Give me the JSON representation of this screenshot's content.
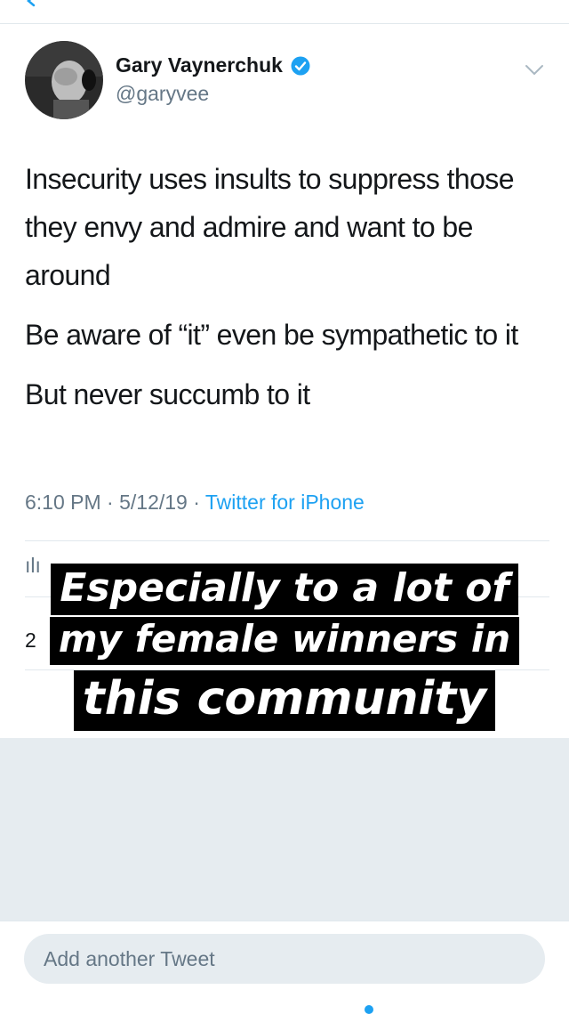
{
  "tweet": {
    "author_name": "Gary Vaynerchuk",
    "handle": "@garyvee",
    "paragraphs": [
      "Insecurity uses insults to suppress those they envy and admire and want to be around",
      "Be aware of “it” even be sympathetic to it",
      "But never succumb to it"
    ],
    "time": "6:10 PM · 5/12/19 ·",
    "source": "Twitter for iPhone",
    "stats_partial": "ılı",
    "count_partial": "2"
  },
  "reply": {
    "placeholder": "Add another Tweet"
  },
  "caption": {
    "line1": "Especially to a lot of",
    "line2": "my female winners in",
    "line3": "this community"
  },
  "colors": {
    "accent": "#1da1f2",
    "secondary_text": "#657786",
    "background_gray": "#e6ecf0",
    "caption_bg": "#000000"
  },
  "icons": [
    "back-icon",
    "verified-icon",
    "chevron-down-icon",
    "avatar"
  ]
}
